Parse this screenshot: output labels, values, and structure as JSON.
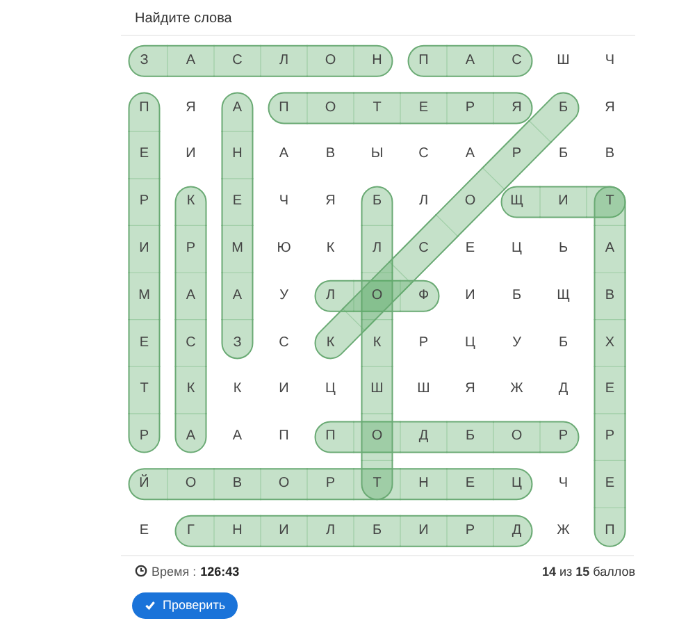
{
  "title": "Найдите слова",
  "grid": [
    [
      {
        "letter": "З",
        "marks": [
          {
            "kind": "across",
            "start": true,
            "end": false
          }
        ]
      },
      {
        "letter": "А",
        "marks": [
          {
            "kind": "across",
            "start": false,
            "end": false
          }
        ]
      },
      {
        "letter": "С",
        "marks": [
          {
            "kind": "across",
            "start": false,
            "end": false
          }
        ]
      },
      {
        "letter": "Л",
        "marks": [
          {
            "kind": "across",
            "start": false,
            "end": false
          }
        ]
      },
      {
        "letter": "О",
        "marks": [
          {
            "kind": "across",
            "start": false,
            "end": false
          }
        ]
      },
      {
        "letter": "Н",
        "marks": [
          {
            "kind": "across",
            "start": false,
            "end": true
          }
        ]
      },
      {
        "letter": "П",
        "marks": [
          {
            "kind": "across",
            "start": true,
            "end": false
          }
        ]
      },
      {
        "letter": "А",
        "marks": [
          {
            "kind": "across",
            "start": false,
            "end": false
          }
        ]
      },
      {
        "letter": "С",
        "marks": [
          {
            "kind": "across",
            "start": false,
            "end": true
          }
        ]
      },
      {
        "letter": "Ш"
      },
      {
        "letter": "Ч"
      }
    ],
    [
      {
        "letter": "П",
        "marks": [
          {
            "kind": "down",
            "start": true,
            "end": false
          }
        ]
      },
      {
        "letter": "Я"
      },
      {
        "letter": "А",
        "marks": [
          {
            "kind": "down",
            "start": true,
            "end": false
          }
        ]
      },
      {
        "letter": "П",
        "marks": [
          {
            "kind": "across",
            "start": true,
            "end": false
          }
        ]
      },
      {
        "letter": "О",
        "marks": [
          {
            "kind": "across",
            "start": false,
            "end": false
          }
        ]
      },
      {
        "letter": "Т",
        "marks": [
          {
            "kind": "across",
            "start": false,
            "end": false
          }
        ]
      },
      {
        "letter": "Е",
        "marks": [
          {
            "kind": "across",
            "start": false,
            "end": false
          }
        ]
      },
      {
        "letter": "Р",
        "marks": [
          {
            "kind": "across",
            "start": false,
            "end": false
          }
        ]
      },
      {
        "letter": "Я",
        "marks": [
          {
            "kind": "across",
            "start": false,
            "end": true
          }
        ]
      },
      {
        "letter": "Б",
        "marks": [
          {
            "kind": "diagonal",
            "start": true,
            "end": false
          }
        ]
      },
      {
        "letter": "Я"
      }
    ],
    [
      {
        "letter": "Е",
        "marks": [
          {
            "kind": "down",
            "start": false,
            "end": false
          }
        ]
      },
      {
        "letter": "И"
      },
      {
        "letter": "Н",
        "marks": [
          {
            "kind": "down",
            "start": false,
            "end": false
          }
        ]
      },
      {
        "letter": "А"
      },
      {
        "letter": "В"
      },
      {
        "letter": "Ы"
      },
      {
        "letter": "С"
      },
      {
        "letter": "А"
      },
      {
        "letter": "Р",
        "marks": [
          {
            "kind": "diagonal",
            "start": false,
            "end": false
          }
        ]
      },
      {
        "letter": "Б"
      },
      {
        "letter": "В"
      }
    ],
    [
      {
        "letter": "Р",
        "marks": [
          {
            "kind": "down",
            "start": false,
            "end": false
          }
        ]
      },
      {
        "letter": "К",
        "marks": [
          {
            "kind": "down",
            "start": true,
            "end": false
          }
        ]
      },
      {
        "letter": "Е",
        "marks": [
          {
            "kind": "down",
            "start": false,
            "end": false
          }
        ]
      },
      {
        "letter": "Ч"
      },
      {
        "letter": "Я"
      },
      {
        "letter": "Б",
        "marks": [
          {
            "kind": "down",
            "start": true,
            "end": false
          }
        ]
      },
      {
        "letter": "Л"
      },
      {
        "letter": "О",
        "marks": [
          {
            "kind": "diagonal",
            "start": false,
            "end": false
          }
        ]
      },
      {
        "letter": "Щ",
        "marks": [
          {
            "kind": "across",
            "start": true,
            "end": false
          }
        ]
      },
      {
        "letter": "И",
        "marks": [
          {
            "kind": "across",
            "start": false,
            "end": false
          }
        ]
      },
      {
        "letter": "Т",
        "marks": [
          {
            "kind": "across",
            "start": false,
            "end": true
          },
          {
            "kind": "down",
            "start": true,
            "end": false
          }
        ]
      }
    ],
    [
      {
        "letter": "И",
        "marks": [
          {
            "kind": "down",
            "start": false,
            "end": false
          }
        ]
      },
      {
        "letter": "Р",
        "marks": [
          {
            "kind": "down",
            "start": false,
            "end": false
          }
        ]
      },
      {
        "letter": "М",
        "marks": [
          {
            "kind": "down",
            "start": false,
            "end": false
          }
        ]
      },
      {
        "letter": "Ю"
      },
      {
        "letter": "К"
      },
      {
        "letter": "Л",
        "marks": [
          {
            "kind": "down",
            "start": false,
            "end": false
          }
        ]
      },
      {
        "letter": "С",
        "marks": [
          {
            "kind": "diagonal",
            "start": false,
            "end": false
          }
        ]
      },
      {
        "letter": "Е"
      },
      {
        "letter": "Ц"
      },
      {
        "letter": "Ь"
      },
      {
        "letter": "А",
        "marks": [
          {
            "kind": "down",
            "start": false,
            "end": false
          }
        ]
      }
    ],
    [
      {
        "letter": "М",
        "marks": [
          {
            "kind": "down",
            "start": false,
            "end": false
          }
        ]
      },
      {
        "letter": "А",
        "marks": [
          {
            "kind": "down",
            "start": false,
            "end": false
          }
        ]
      },
      {
        "letter": "А",
        "marks": [
          {
            "kind": "down",
            "start": false,
            "end": false
          }
        ]
      },
      {
        "letter": "У"
      },
      {
        "letter": "Л",
        "marks": [
          {
            "kind": "across",
            "start": true,
            "end": false
          }
        ]
      },
      {
        "letter": "О",
        "marks": [
          {
            "kind": "across",
            "start": false,
            "end": false
          },
          {
            "kind": "down",
            "start": false,
            "end": false
          },
          {
            "kind": "diagonal",
            "start": false,
            "end": false
          }
        ]
      },
      {
        "letter": "Ф",
        "marks": [
          {
            "kind": "across",
            "start": false,
            "end": true
          }
        ]
      },
      {
        "letter": "И"
      },
      {
        "letter": "Б"
      },
      {
        "letter": "Щ"
      },
      {
        "letter": "В",
        "marks": [
          {
            "kind": "down",
            "start": false,
            "end": false
          }
        ]
      }
    ],
    [
      {
        "letter": "Е",
        "marks": [
          {
            "kind": "down",
            "start": false,
            "end": false
          }
        ]
      },
      {
        "letter": "С",
        "marks": [
          {
            "kind": "down",
            "start": false,
            "end": false
          }
        ]
      },
      {
        "letter": "З",
        "marks": [
          {
            "kind": "down",
            "start": false,
            "end": true
          }
        ]
      },
      {
        "letter": "С"
      },
      {
        "letter": "К",
        "marks": [
          {
            "kind": "diagonal",
            "start": false,
            "end": true
          }
        ]
      },
      {
        "letter": "К",
        "marks": [
          {
            "kind": "down",
            "start": false,
            "end": false
          }
        ]
      },
      {
        "letter": "Р"
      },
      {
        "letter": "Ц"
      },
      {
        "letter": "У"
      },
      {
        "letter": "Б"
      },
      {
        "letter": "Х",
        "marks": [
          {
            "kind": "down",
            "start": false,
            "end": false
          }
        ]
      }
    ],
    [
      {
        "letter": "Т",
        "marks": [
          {
            "kind": "down",
            "start": false,
            "end": false
          }
        ]
      },
      {
        "letter": "К",
        "marks": [
          {
            "kind": "down",
            "start": false,
            "end": false
          }
        ]
      },
      {
        "letter": "К"
      },
      {
        "letter": "И"
      },
      {
        "letter": "Ц"
      },
      {
        "letter": "Ш",
        "marks": [
          {
            "kind": "down",
            "start": false,
            "end": false
          }
        ]
      },
      {
        "letter": "Ш"
      },
      {
        "letter": "Я"
      },
      {
        "letter": "Ж"
      },
      {
        "letter": "Д"
      },
      {
        "letter": "Е",
        "marks": [
          {
            "kind": "down",
            "start": false,
            "end": false
          }
        ]
      }
    ],
    [
      {
        "letter": "Р",
        "marks": [
          {
            "kind": "down",
            "start": false,
            "end": true
          }
        ]
      },
      {
        "letter": "А",
        "marks": [
          {
            "kind": "down",
            "start": false,
            "end": true
          }
        ]
      },
      {
        "letter": "А"
      },
      {
        "letter": "П"
      },
      {
        "letter": "П",
        "marks": [
          {
            "kind": "across",
            "start": true,
            "end": false
          }
        ]
      },
      {
        "letter": "О",
        "marks": [
          {
            "kind": "across",
            "start": false,
            "end": false
          },
          {
            "kind": "down",
            "start": false,
            "end": false
          }
        ]
      },
      {
        "letter": "Д",
        "marks": [
          {
            "kind": "across",
            "start": false,
            "end": false
          }
        ]
      },
      {
        "letter": "Б",
        "marks": [
          {
            "kind": "across",
            "start": false,
            "end": false
          }
        ]
      },
      {
        "letter": "О",
        "marks": [
          {
            "kind": "across",
            "start": false,
            "end": false
          }
        ]
      },
      {
        "letter": "Р",
        "marks": [
          {
            "kind": "across",
            "start": false,
            "end": true
          }
        ]
      },
      {
        "letter": "Р",
        "marks": [
          {
            "kind": "down",
            "start": false,
            "end": false
          }
        ]
      }
    ],
    [
      {
        "letter": "Й",
        "marks": [
          {
            "kind": "across",
            "start": true,
            "end": false
          }
        ]
      },
      {
        "letter": "О",
        "marks": [
          {
            "kind": "across",
            "start": false,
            "end": false
          }
        ]
      },
      {
        "letter": "В",
        "marks": [
          {
            "kind": "across",
            "start": false,
            "end": false
          }
        ]
      },
      {
        "letter": "О",
        "marks": [
          {
            "kind": "across",
            "start": false,
            "end": false
          }
        ]
      },
      {
        "letter": "Р",
        "marks": [
          {
            "kind": "across",
            "start": false,
            "end": false
          }
        ]
      },
      {
        "letter": "Т",
        "marks": [
          {
            "kind": "across",
            "start": false,
            "end": false
          },
          {
            "kind": "down",
            "start": false,
            "end": true
          }
        ]
      },
      {
        "letter": "Н",
        "marks": [
          {
            "kind": "across",
            "start": false,
            "end": false
          }
        ]
      },
      {
        "letter": "Е",
        "marks": [
          {
            "kind": "across",
            "start": false,
            "end": false
          }
        ]
      },
      {
        "letter": "Ц",
        "marks": [
          {
            "kind": "across",
            "start": false,
            "end": true
          }
        ]
      },
      {
        "letter": "Ч"
      },
      {
        "letter": "Е",
        "marks": [
          {
            "kind": "down",
            "start": false,
            "end": false
          }
        ]
      }
    ],
    [
      {
        "letter": "Е"
      },
      {
        "letter": "Г",
        "marks": [
          {
            "kind": "across",
            "start": true,
            "end": false
          }
        ]
      },
      {
        "letter": "Н",
        "marks": [
          {
            "kind": "across",
            "start": false,
            "end": false
          }
        ]
      },
      {
        "letter": "И",
        "marks": [
          {
            "kind": "across",
            "start": false,
            "end": false
          }
        ]
      },
      {
        "letter": "Л",
        "marks": [
          {
            "kind": "across",
            "start": false,
            "end": false
          }
        ]
      },
      {
        "letter": "Б",
        "marks": [
          {
            "kind": "across",
            "start": false,
            "end": false
          }
        ]
      },
      {
        "letter": "И",
        "marks": [
          {
            "kind": "across",
            "start": false,
            "end": false
          }
        ]
      },
      {
        "letter": "Р",
        "marks": [
          {
            "kind": "across",
            "start": false,
            "end": false
          }
        ]
      },
      {
        "letter": "Д",
        "marks": [
          {
            "kind": "across",
            "start": false,
            "end": true
          }
        ]
      },
      {
        "letter": "Ж"
      },
      {
        "letter": "П",
        "marks": [
          {
            "kind": "down",
            "start": false,
            "end": true
          }
        ]
      }
    ]
  ],
  "timer": {
    "label": "Время :",
    "value": "126:43"
  },
  "score": "**14** из **15** баллов",
  "check_button": "Проверить"
}
